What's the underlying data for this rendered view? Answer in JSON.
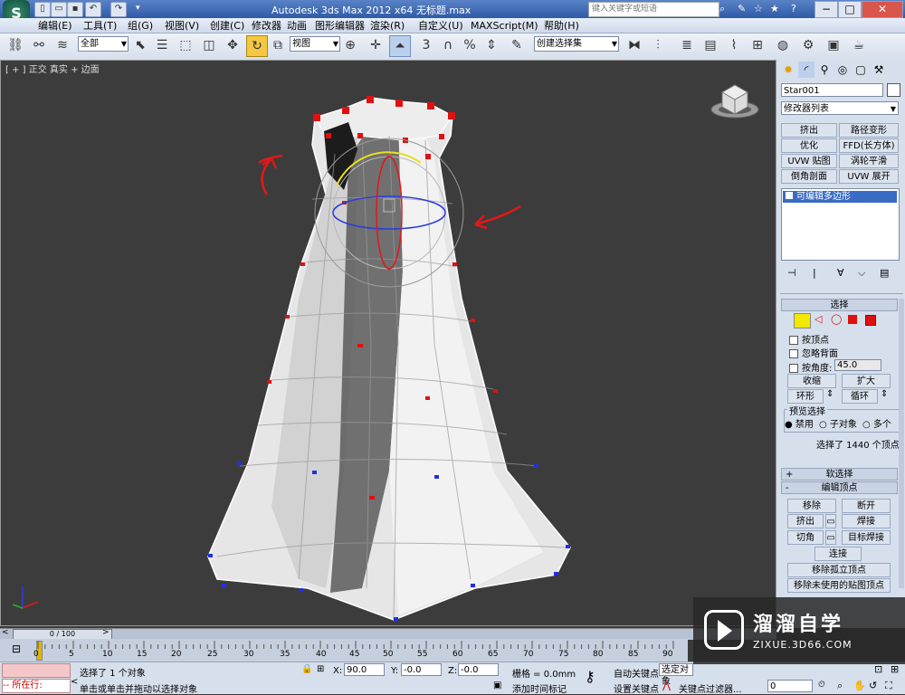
{
  "window": {
    "title": "Autodesk 3ds Max  2012 x64   无标题.max",
    "search_placeholder": "键入关键字或短语"
  },
  "menu": [
    "编辑(E)",
    "工具(T)",
    "组(G)",
    "视图(V)",
    "创建(C)",
    "修改器",
    "动画",
    "图形编辑器",
    "渲染(R)",
    "自定义(U)",
    "MAXScript(M)",
    "帮助(H)"
  ],
  "toolbar": {
    "selection_filter": "全部",
    "reference_coord": "视图",
    "snap_labels": [
      "3",
      "%"
    ],
    "named_selection": "创建选择集"
  },
  "viewport": {
    "label": "[ + ] 正交 ] 真实 + 边面 ]",
    "label_parts": [
      "[ + ]",
      "正交",
      "真实 + 边面"
    ]
  },
  "command_panel": {
    "object_name": "Star001",
    "modifier_list": "修改器列表",
    "modifier_buttons": [
      "挤出",
      "路径变形",
      "优化",
      "FFD(长方体)",
      "UVW 贴图",
      "涡轮平滑",
      "倒角剖面",
      "UVW 展开"
    ],
    "stack_item": "可编辑多边形",
    "selection": {
      "title": "选择",
      "by_vertex": "按顶点",
      "ignore_backfacing": "忽略背面",
      "by_angle": "按角度:",
      "angle_value": "45.0",
      "shrink": "收缩",
      "grow": "扩大",
      "ring": "环形",
      "loop": "循环",
      "preview_title": "预览选择",
      "preview_options": [
        "禁用",
        "子对象",
        "多个"
      ],
      "status": "选择了 1440 个顶点"
    },
    "soft_selection": "软选择",
    "edit_vertices": {
      "title": "编辑顶点",
      "buttons": [
        "移除",
        "断开",
        "挤出",
        "焊接",
        "切角",
        "目标焊接",
        "连接",
        "移除孤立顶点",
        "移除未使用的贴图顶点"
      ]
    }
  },
  "timeline": {
    "frame_display": "0 / 100",
    "ticks": [
      "0",
      "5",
      "10",
      "15",
      "20",
      "25",
      "30",
      "35",
      "40",
      "45",
      "50",
      "55",
      "60",
      "65",
      "70",
      "75",
      "80",
      "85",
      "90"
    ]
  },
  "status": {
    "running": "所在行:",
    "selected": "选择了 1 个对象",
    "prompt": "单击或单击并拖动以选择对象",
    "x_label": "X:",
    "x_value": "90.0",
    "y_label": "Y:",
    "y_value": "-0.0",
    "z_label": "Z:",
    "z_value": "-0.0",
    "grid": "栅格 = 0.0mm",
    "add_time_tag": "添加时间标记",
    "auto_key": "自动关键点",
    "set_key": "设置关键点",
    "selected_set": "选定对象",
    "key_filters": "关键点过滤器...",
    "frame_value": "0"
  },
  "watermark": {
    "brand": "溜溜自学",
    "url": "ZIXUE.3D66.COM"
  },
  "colors": {
    "accent_blue": "#3a6bc4",
    "vertex_red": "#e01010",
    "vertex_blue": "#2030e0"
  }
}
